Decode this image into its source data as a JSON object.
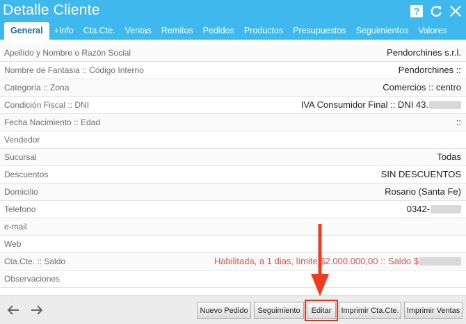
{
  "window": {
    "title": "Detalle Cliente"
  },
  "tabs": [
    {
      "label": "General",
      "active": true
    },
    {
      "label": "+Info"
    },
    {
      "label": "Cta.Cte."
    },
    {
      "label": "Ventas"
    },
    {
      "label": "Remitos"
    },
    {
      "label": "Pedidos"
    },
    {
      "label": "Productos"
    },
    {
      "label": "Presupuestos"
    },
    {
      "label": "Seguimientos"
    },
    {
      "label": "Valores"
    }
  ],
  "fields": [
    {
      "label": "Apellido y Nombre o Razón Social",
      "value": "Pendorchines s.r.l."
    },
    {
      "label": "Nombre de Fantasia :: Código Interno",
      "value": "Pendorchines ::"
    },
    {
      "label": "Categoría :: Zona",
      "value": "Comercios :: centro"
    },
    {
      "label": "Condición Fiscal :: DNI",
      "value": "IVA Consumidor Final :: DNI 43."
    },
    {
      "label": "Fecha Nacimiento :: Edad",
      "value": "::"
    },
    {
      "label": "Vendedor",
      "value": ""
    },
    {
      "label": "Sucursal",
      "value": "Todas"
    },
    {
      "label": "Descuentos",
      "value": "SIN DESCUENTOS"
    },
    {
      "label": "Domicilio",
      "value": "Rosario (Santa Fe)"
    },
    {
      "label": "Telefono",
      "value": "0342-"
    },
    {
      "label": "e-mail",
      "value": ""
    },
    {
      "label": "Web",
      "value": ""
    },
    {
      "label": "Cta.Cte. :: Saldo",
      "value": "Habilitada, a 1 dias, límite $2.000.000,00 :: Saldo $"
    },
    {
      "label": "Observaciones",
      "value": ""
    }
  ],
  "footer": {
    "buttons": [
      {
        "label": "Nuevo Pedido"
      },
      {
        "label": "Seguimiento"
      },
      {
        "label": "Editar"
      },
      {
        "label": "Imprimir Cta.Cte."
      },
      {
        "label": "Imprimir Ventas"
      }
    ]
  },
  "colors": {
    "header": "#3fb8ee",
    "active_tab_text": "#1c6fa8",
    "balance_text": "#e4574d",
    "highlight": "#e0321b"
  },
  "icons": [
    "help-icon",
    "refresh-icon",
    "close-icon",
    "back-arrow-icon",
    "forward-arrow-icon"
  ]
}
